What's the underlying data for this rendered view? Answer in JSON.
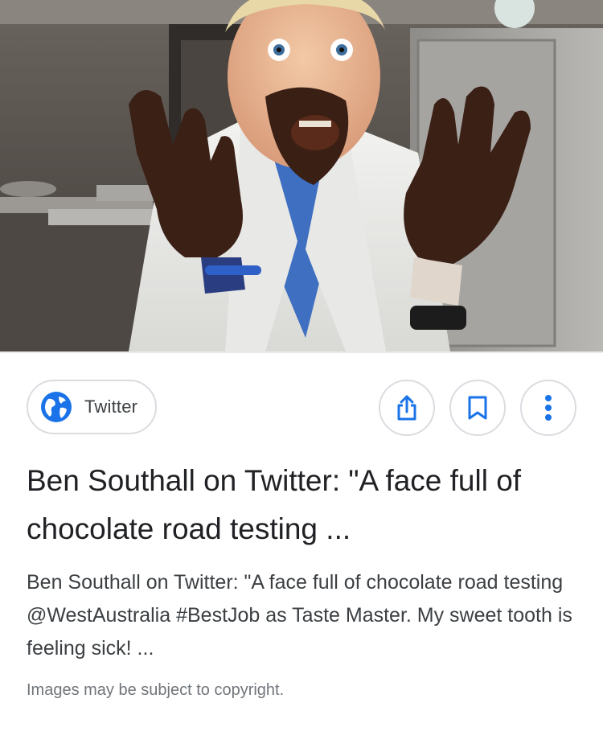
{
  "result_image": {
    "description_icon": "photo"
  },
  "source": {
    "name": "Twitter",
    "icon": "globe-icon"
  },
  "actions": {
    "share_icon": "share-icon",
    "save_icon": "bookmark-icon",
    "more_icon": "more-vert-icon"
  },
  "result": {
    "title": "Ben Southall on Twitter: \"A face full of chocolate road testing ...",
    "snippet": "Ben Southall on Twitter: \"A face full of chocolate road testing @WestAustralia #BestJob as Taste Master. My sweet tooth is feeling sick! ...",
    "copyright_notice": "Images may be subject to copyright."
  },
  "colors": {
    "accent_blue": "#1a73e8",
    "border": "#dadce0",
    "title_text": "#202124",
    "secondary_text": "#70757a"
  }
}
